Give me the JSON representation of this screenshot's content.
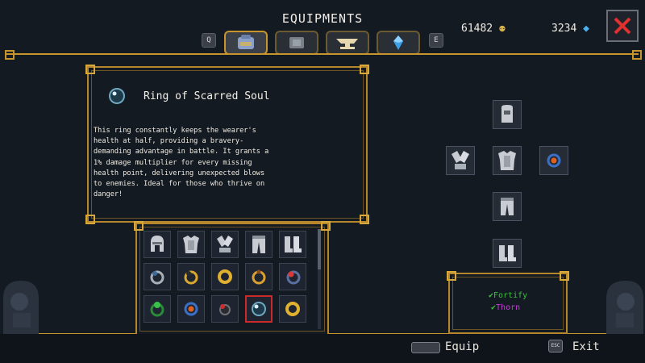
{
  "header": {
    "title": "EQUIPMENTS",
    "tab_prev_key": "Q",
    "tab_next_key": "E",
    "tabs": [
      {
        "name": "inventory-tab",
        "icon": "backpack-icon",
        "active": true
      },
      {
        "name": "armor-tab",
        "icon": "armor-icon",
        "active": false
      },
      {
        "name": "forge-tab",
        "icon": "anvil-icon",
        "active": false
      },
      {
        "name": "crystal-tab",
        "icon": "crystal-icon",
        "active": false
      }
    ],
    "gold_amount": "61482",
    "crystal_amount": "3234"
  },
  "description": {
    "item_name": "Ring of Scarred Soul",
    "item_icon": "dark-orb-ring-icon",
    "text": "This ring constantly keeps the wearer's health at half, providing a bravery-demanding advantage in battle. It grants a 1% damage multiplier for every missing health point, delivering unexpected blows to enemies. Ideal for those who thrive on danger!"
  },
  "inventory": {
    "rows": [
      [
        "helmet",
        "chestplate",
        "gauntlets",
        "pants",
        "boots"
      ],
      [
        "ring-silver",
        "ring-gold",
        "ring-gold",
        "ring-gold",
        "ring-blue-gem"
      ],
      [
        "ring-emerald",
        "ring-ruby-gem",
        "ring-dark",
        "ring-dark-orb",
        "ring-gold"
      ]
    ],
    "selected": [
      2,
      3
    ]
  },
  "equipped": {
    "perks": [
      {
        "label": "Fortify",
        "color": "#3fbf3f"
      },
      {
        "label": "Thorn",
        "color": "#c23fd6"
      }
    ]
  },
  "footer": {
    "equip_label": "Equip",
    "exit_key": "ESC",
    "exit_label": "Exit"
  },
  "colors": {
    "frame_gold": "#c8952c",
    "background": "#141a22",
    "selected_border": "#cc2a2a",
    "close_red": "#e03030"
  }
}
